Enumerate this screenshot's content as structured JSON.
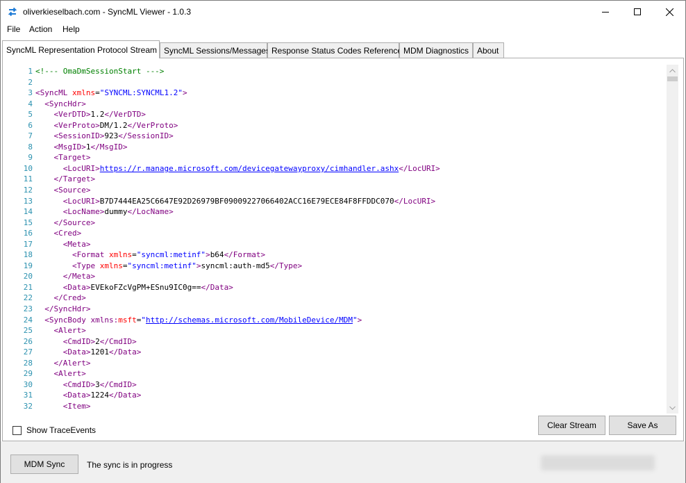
{
  "window": {
    "title": "oliverkieselbach.com - SyncML Viewer - 1.0.3"
  },
  "menu": {
    "items": [
      "File",
      "Action",
      "Help"
    ]
  },
  "tabs": [
    {
      "label": "SyncML Representation Protocol Stream",
      "active": true
    },
    {
      "label": "SyncML Sessions/Messages",
      "active": false
    },
    {
      "label": "Response Status Codes Reference",
      "active": false
    },
    {
      "label": "MDM Diagnostics",
      "active": false
    },
    {
      "label": "About",
      "active": false
    }
  ],
  "colors": {
    "comment": "#008000",
    "tag": "#800080",
    "attribute": "#ff0000",
    "value": "#0000ff",
    "line_number": "#2b91af",
    "app_icon": "#1e7bd6"
  },
  "code": [
    {
      "n": "1",
      "indent": 0,
      "parts": [
        [
          "c",
          "<!--- OmaDmSessionStart --->"
        ]
      ]
    },
    {
      "n": "2",
      "indent": 0,
      "parts": []
    },
    {
      "n": "3",
      "indent": 0,
      "parts": [
        [
          "t",
          "<SyncML "
        ],
        [
          "a",
          "xmlns"
        ],
        [
          "x",
          "="
        ],
        [
          "v",
          "\"SYNCML:SYNCML1.2\""
        ],
        [
          "t",
          ">"
        ]
      ]
    },
    {
      "n": "4",
      "indent": 2,
      "parts": [
        [
          "t",
          "<SyncHdr>"
        ]
      ]
    },
    {
      "n": "5",
      "indent": 4,
      "parts": [
        [
          "t",
          "<VerDTD>"
        ],
        [
          "x",
          "1.2"
        ],
        [
          "t",
          "</VerDTD>"
        ]
      ]
    },
    {
      "n": "6",
      "indent": 4,
      "parts": [
        [
          "t",
          "<VerProto>"
        ],
        [
          "x",
          "DM/1.2"
        ],
        [
          "t",
          "</VerProto>"
        ]
      ]
    },
    {
      "n": "7",
      "indent": 4,
      "parts": [
        [
          "t",
          "<SessionID>"
        ],
        [
          "x",
          "923"
        ],
        [
          "t",
          "</SessionID>"
        ]
      ]
    },
    {
      "n": "8",
      "indent": 4,
      "parts": [
        [
          "t",
          "<MsgID>"
        ],
        [
          "x",
          "1"
        ],
        [
          "t",
          "</MsgID>"
        ]
      ]
    },
    {
      "n": "9",
      "indent": 4,
      "parts": [
        [
          "t",
          "<Target>"
        ]
      ]
    },
    {
      "n": "10",
      "indent": 6,
      "parts": [
        [
          "t",
          "<LocURI>"
        ],
        [
          "l",
          "https://r.manage.microsoft.com/devicegatewayproxy/cimhandler.ashx"
        ],
        [
          "t",
          "</LocURI>"
        ]
      ]
    },
    {
      "n": "11",
      "indent": 4,
      "parts": [
        [
          "t",
          "</Target>"
        ]
      ]
    },
    {
      "n": "12",
      "indent": 4,
      "parts": [
        [
          "t",
          "<Source>"
        ]
      ]
    },
    {
      "n": "13",
      "indent": 6,
      "parts": [
        [
          "t",
          "<LocURI>"
        ],
        [
          "x",
          "B7D7444EA25C6647E92D26979BF09009227066402ACC16E79ECE84F8FFDDC070"
        ],
        [
          "t",
          "</LocURI>"
        ]
      ]
    },
    {
      "n": "14",
      "indent": 6,
      "parts": [
        [
          "t",
          "<LocName>"
        ],
        [
          "x",
          "dummy"
        ],
        [
          "t",
          "</LocName>"
        ]
      ]
    },
    {
      "n": "15",
      "indent": 4,
      "parts": [
        [
          "t",
          "</Source>"
        ]
      ]
    },
    {
      "n": "16",
      "indent": 4,
      "parts": [
        [
          "t",
          "<Cred>"
        ]
      ]
    },
    {
      "n": "17",
      "indent": 6,
      "parts": [
        [
          "t",
          "<Meta>"
        ]
      ]
    },
    {
      "n": "18",
      "indent": 8,
      "parts": [
        [
          "t",
          "<Format "
        ],
        [
          "a",
          "xmlns"
        ],
        [
          "x",
          "="
        ],
        [
          "v",
          "\"syncml:metinf\""
        ],
        [
          "t",
          ">"
        ],
        [
          "x",
          "b64"
        ],
        [
          "t",
          "</Format>"
        ]
      ]
    },
    {
      "n": "19",
      "indent": 8,
      "parts": [
        [
          "t",
          "<Type "
        ],
        [
          "a",
          "xmlns"
        ],
        [
          "x",
          "="
        ],
        [
          "v",
          "\"syncml:metinf\""
        ],
        [
          "t",
          ">"
        ],
        [
          "x",
          "syncml:auth-md5"
        ],
        [
          "t",
          "</Type>"
        ]
      ]
    },
    {
      "n": "20",
      "indent": 6,
      "parts": [
        [
          "t",
          "</Meta>"
        ]
      ]
    },
    {
      "n": "21",
      "indent": 6,
      "parts": [
        [
          "t",
          "<Data>"
        ],
        [
          "x",
          "EVEkoFZcVgPM+ESnu9IC0g=="
        ],
        [
          "t",
          "</Data>"
        ]
      ]
    },
    {
      "n": "22",
      "indent": 4,
      "parts": [
        [
          "t",
          "</Cred>"
        ]
      ]
    },
    {
      "n": "23",
      "indent": 2,
      "parts": [
        [
          "t",
          "</SyncHdr>"
        ]
      ]
    },
    {
      "n": "24",
      "indent": 2,
      "parts": [
        [
          "t",
          "<SyncBody "
        ],
        [
          "t",
          "xmlns:"
        ],
        [
          "a",
          "msft"
        ],
        [
          "x",
          "="
        ],
        [
          "v",
          "\""
        ],
        [
          "l",
          "http://schemas.microsoft.com/MobileDevice/MDM"
        ],
        [
          "v",
          "\""
        ],
        [
          "t",
          ">"
        ]
      ]
    },
    {
      "n": "25",
      "indent": 4,
      "parts": [
        [
          "t",
          "<Alert>"
        ]
      ]
    },
    {
      "n": "26",
      "indent": 6,
      "parts": [
        [
          "t",
          "<CmdID>"
        ],
        [
          "x",
          "2"
        ],
        [
          "t",
          "</CmdID>"
        ]
      ]
    },
    {
      "n": "27",
      "indent": 6,
      "parts": [
        [
          "t",
          "<Data>"
        ],
        [
          "x",
          "1201"
        ],
        [
          "t",
          "</Data>"
        ]
      ]
    },
    {
      "n": "28",
      "indent": 4,
      "parts": [
        [
          "t",
          "</Alert>"
        ]
      ]
    },
    {
      "n": "29",
      "indent": 4,
      "parts": [
        [
          "t",
          "<Alert>"
        ]
      ]
    },
    {
      "n": "30",
      "indent": 6,
      "parts": [
        [
          "t",
          "<CmdID>"
        ],
        [
          "x",
          "3"
        ],
        [
          "t",
          "</CmdID>"
        ]
      ]
    },
    {
      "n": "31",
      "indent": 6,
      "parts": [
        [
          "t",
          "<Data>"
        ],
        [
          "x",
          "1224"
        ],
        [
          "t",
          "</Data>"
        ]
      ]
    },
    {
      "n": "32",
      "indent": 6,
      "parts": [
        [
          "t",
          "<Item>"
        ]
      ]
    }
  ],
  "controls": {
    "show_trace_label": "Show TraceEvents",
    "show_trace_checked": false,
    "clear_stream_label": "Clear Stream",
    "save_as_label": "Save As",
    "mdm_sync_label": "MDM Sync"
  },
  "status": {
    "text": "The sync is in progress"
  }
}
